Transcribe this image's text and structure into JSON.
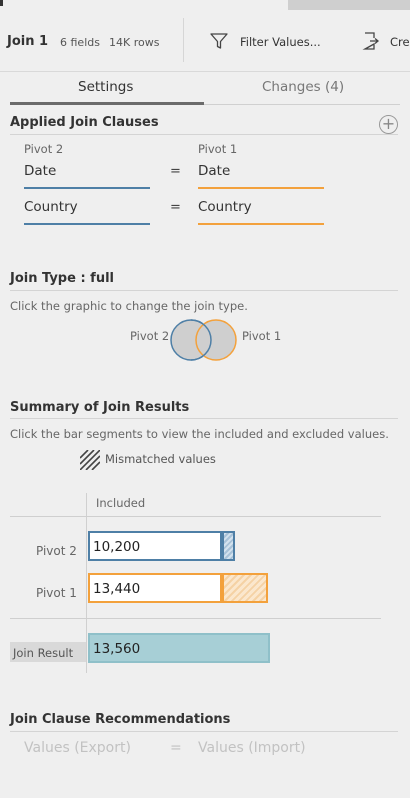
{
  "header": {
    "title": "Join 1",
    "fields": "6 fields",
    "rows": "14K rows",
    "filter_label": "Filter Values...",
    "create_label": "Cre"
  },
  "tabs": [
    {
      "label": "Settings",
      "active": true
    },
    {
      "label": "Changes (4)",
      "active": false
    }
  ],
  "clauses": {
    "title": "Applied Join Clauses",
    "left_source": "Pivot 2",
    "right_source": "Pivot 1",
    "rows": [
      {
        "left": "Date",
        "op": "=",
        "right": "Date"
      },
      {
        "left": "Country",
        "op": "=",
        "right": "Country"
      }
    ]
  },
  "join_type": {
    "title": "Join Type : full",
    "hint": "Click the graphic to change the join type.",
    "left_label": "Pivot 2",
    "right_label": "Pivot 1"
  },
  "summary": {
    "title": "Summary of Join Results",
    "hint": "Click the bar segments to view the included and excluded values.",
    "legend": "Mismatched values",
    "column_header": "Included",
    "rows": [
      {
        "label": "Pivot 2",
        "value": "10,200"
      },
      {
        "label": "Pivot 1",
        "value": "13,440"
      }
    ],
    "result_label": "Join Result",
    "result_value": "13,560"
  },
  "recommendations": {
    "title": "Join Clause Recommendations",
    "left": "Values (Export)",
    "op": "=",
    "right": "Values (Import)"
  },
  "colors": {
    "left_source": "#4e7fa6",
    "right_source": "#f3a13c",
    "result": "#a7cfd6"
  }
}
